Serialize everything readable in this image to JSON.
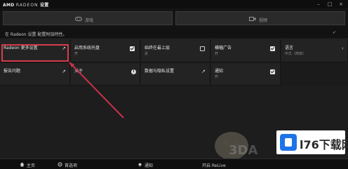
{
  "titlebar": {
    "brand": "AMD",
    "product": "RADEON",
    "title": "设置",
    "minimize": "–",
    "maximize": "□",
    "close": "×"
  },
  "tabs": [
    {
      "label": "游戏",
      "icon": "gamepad-icon"
    },
    {
      "label": "视频",
      "icon": "video-icon"
    }
  ],
  "hint": {
    "text": "在 Radeon 设置 配置附加特性。",
    "right_icon": "link-icon",
    "right_text": "✓"
  },
  "tiles": [
    {
      "title": "Radeon 更多设置",
      "subtitle": "",
      "control": "arrow",
      "highlighted": true
    },
    {
      "title": "启用系统托盘",
      "subtitle": "开",
      "control": "checkbox-on"
    },
    {
      "title": "始终在最上层",
      "subtitle": "关",
      "control": "checkbox-off"
    },
    {
      "title": "横幅广告",
      "subtitle": "开",
      "control": "checkbox-on"
    },
    {
      "title": "语言",
      "subtitle": "中文（简体）",
      "control": "chevron"
    },
    {
      "title": "报告问题",
      "subtitle": "",
      "control": "arrow"
    },
    {
      "title": "关于",
      "subtitle": "",
      "control": "info"
    },
    {
      "title": "数据与隐私设置",
      "subtitle": "",
      "control": "external"
    },
    {
      "title": "通知",
      "subtitle": "开",
      "control": "checkbox-on"
    }
  ],
  "bottombar": {
    "items": [
      {
        "label": "主页",
        "icon": "home-icon"
      },
      {
        "label": "首选项",
        "icon": "preferences-icon"
      },
      {
        "label": "通知",
        "icon": "bell-icon"
      }
    ],
    "right_label": "开启 ReLive"
  },
  "watermark": {
    "left_text": "3DA",
    "site_text": "l76下载网"
  },
  "colors": {
    "highlight": "#d63b4a",
    "tile_bg": "#232323",
    "accent_blue": "#1e73e8"
  }
}
